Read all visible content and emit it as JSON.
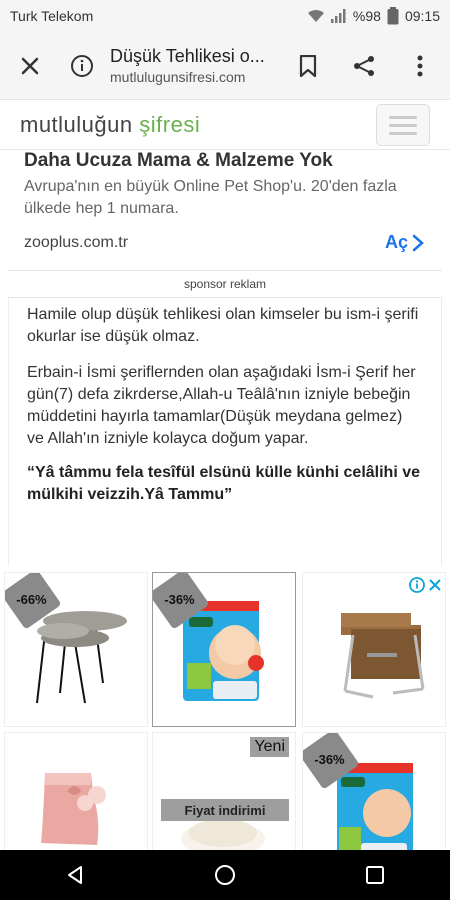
{
  "status_bar": {
    "carrier": "Turk Telekom",
    "battery": "%98",
    "time": "09:15",
    "icons": [
      "wifi-icon",
      "signal-icon",
      "battery-icon"
    ]
  },
  "browser": {
    "page_title": "Düşük Tehlikesi o...",
    "url": "mutlulugunsifresi.com",
    "icons": [
      "close-icon",
      "info-icon",
      "bookmark-icon",
      "share-icon",
      "more-vert-icon"
    ]
  },
  "site": {
    "logo_part1": "mutluluğun",
    "logo_part2": "şifresi",
    "brand_green": "#6ab04c"
  },
  "ad": {
    "headline": "Daha Ucuza Mama & Malzeme Yok",
    "description": "Avrupa'nın en büyük Online Pet Shop'u. 20'den fazla ülkede hep 1 numara.",
    "domain": "zooplus.com.tr",
    "cta": "Aç",
    "cta_color": "#1a73e8"
  },
  "sponsor_label": "sponsor reklam",
  "article": {
    "p1": "Hamile olup düşük tehlikesi olan kimseler bu ism-i şerifi okurlar  ise  düşük olmaz.",
    "p2": "Erbain-i İsmi şeriflernden olan aşağıdaki İsm-i Şerif  her gün(7) defa zikrderse,Allah-u Teâlâ'nın izniyle bebeğin müddetini hayırla tamamlar(Düşük meydana gelmez) ve Allah'ın izniyle kolayca doğum yapar.",
    "quote": "“Yâ tâmmu fela tesîfül elsünü külle künhi celâlihi ve mülkihi veizzih.Yâ Tammu”"
  },
  "products": [
    {
      "discount": "-66%",
      "image": "nesting-tables"
    },
    {
      "discount": "-36%",
      "image": "molfix-diapers-5"
    },
    {
      "discount": null,
      "image": "folding-table"
    },
    {
      "discount": null,
      "image": "pink-boots"
    },
    {
      "discount": null,
      "badge": "Yeni",
      "price_drop": "Fiyat indirimi",
      "image": "white-slippers"
    },
    {
      "discount": "-36%",
      "image": "molfix-diapers-4"
    }
  ],
  "ad_choices_icons": [
    "info-icon",
    "close-icon"
  ],
  "navbar_icons": [
    "back-icon",
    "home-icon",
    "recents-icon"
  ]
}
